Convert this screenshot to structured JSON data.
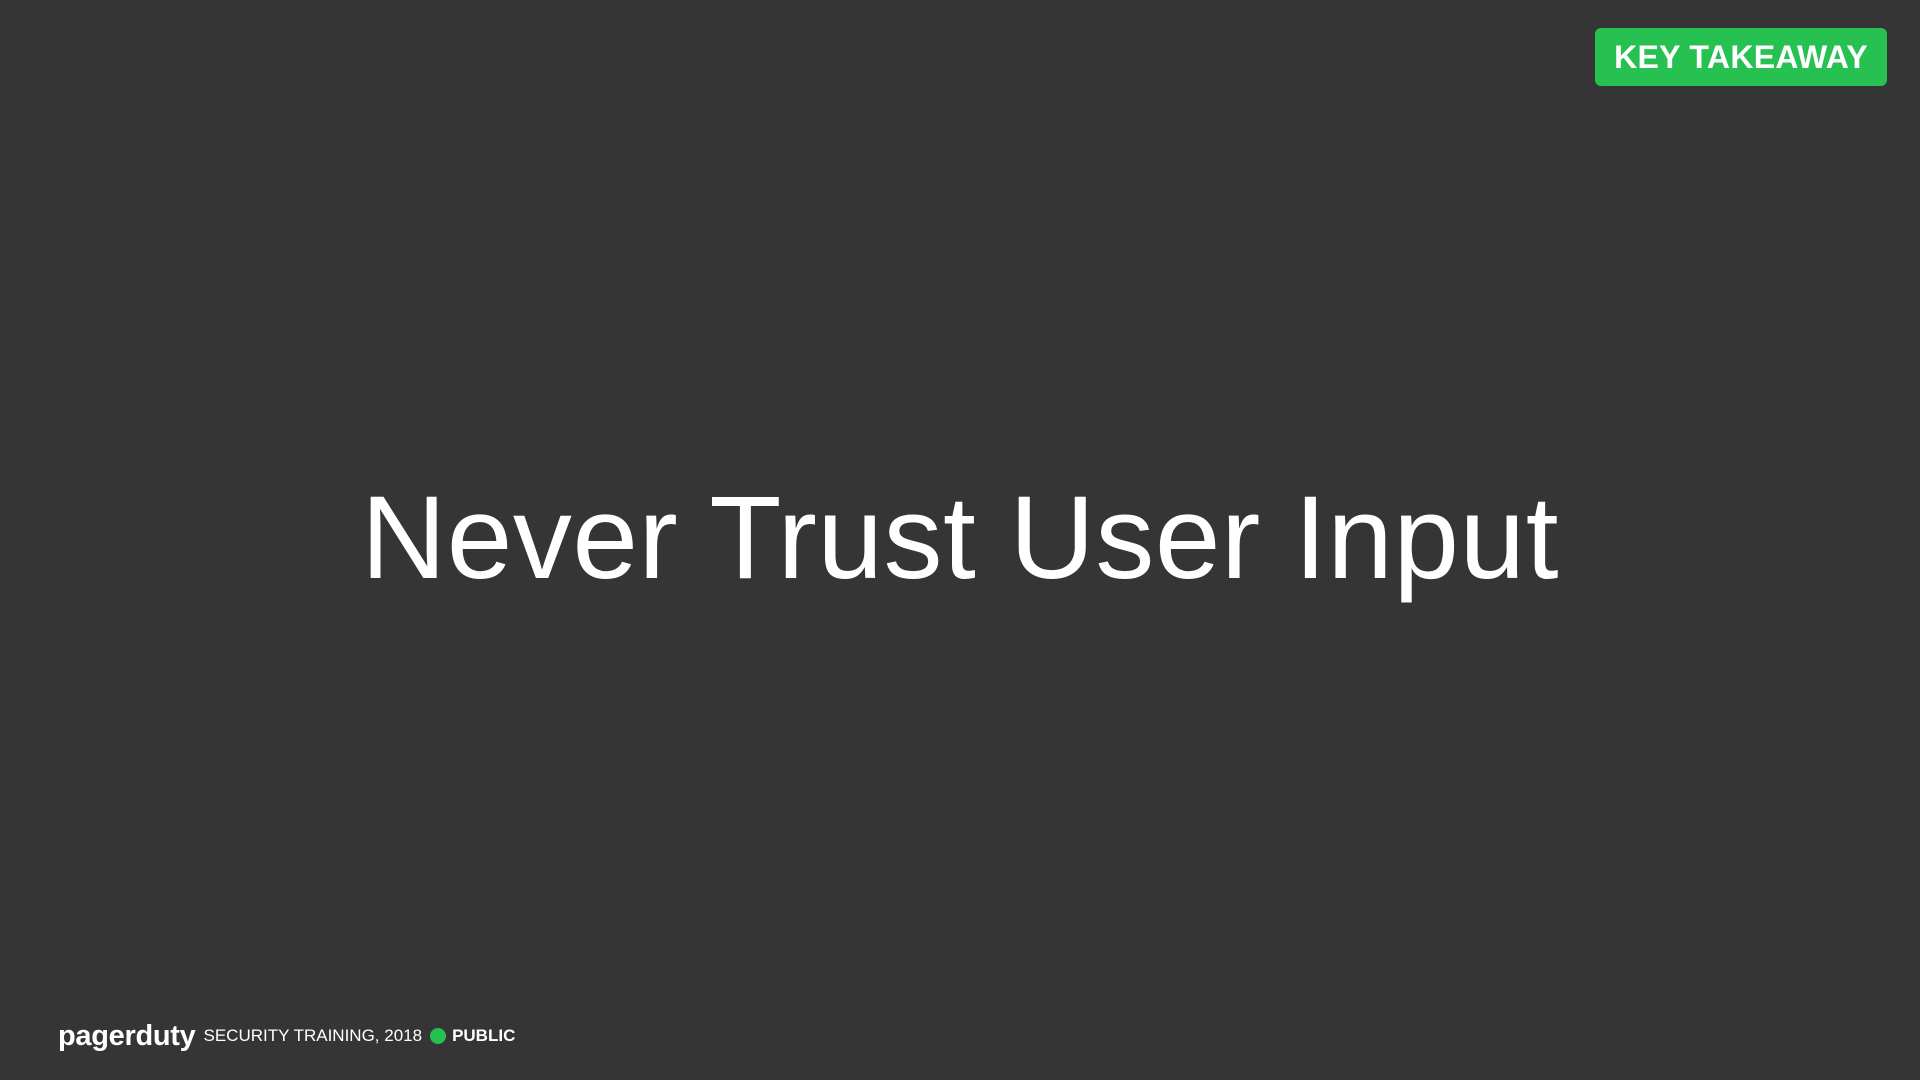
{
  "slide": {
    "badge_label": "KEY TAKEAWAY",
    "headline": "Never Trust User Input"
  },
  "footer": {
    "logo_text": "pagerduty",
    "event_text": "SECURITY TRAINING, 2018",
    "classification": "PUBLIC"
  },
  "colors": {
    "background": "#353535",
    "accent_green": "#27c152",
    "text": "#ffffff"
  }
}
